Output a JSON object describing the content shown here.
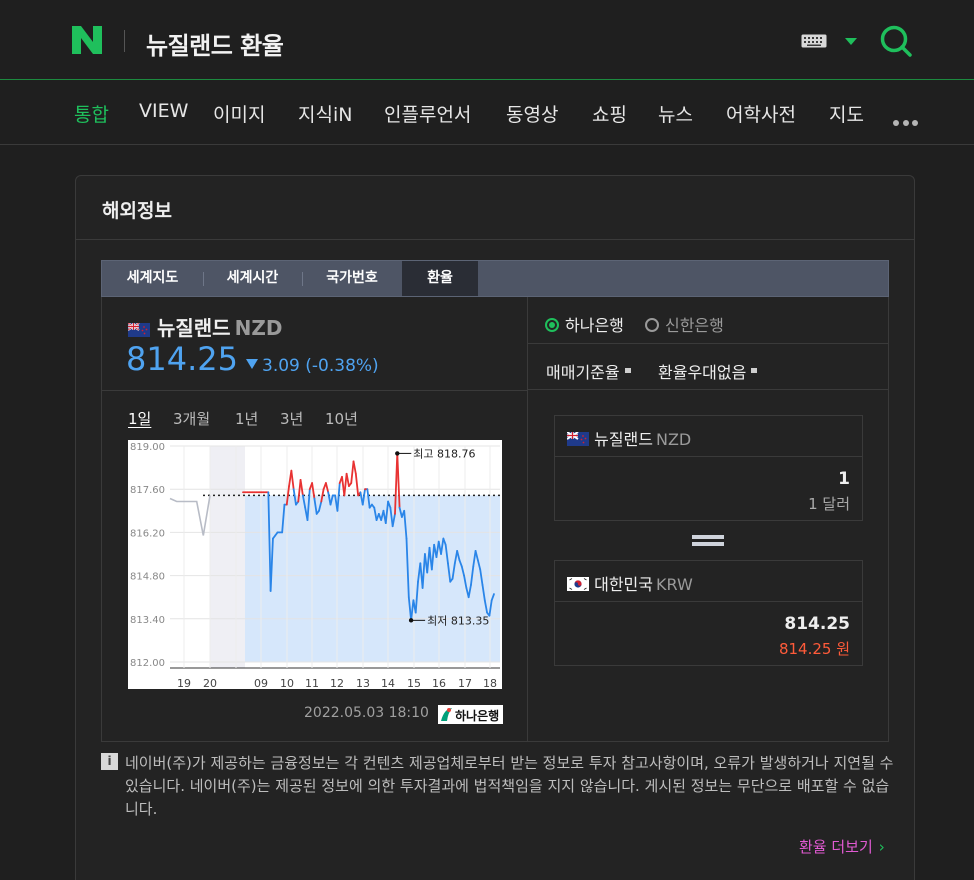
{
  "header": {
    "logo": "N",
    "query": "뉴질랜드 환율",
    "icons": [
      "keyboard-icon",
      "dropdown-triangle-icon",
      "search-icon"
    ],
    "accent_color": "#1fbf5c"
  },
  "tabs": [
    {
      "label": "통합",
      "active": true
    },
    {
      "label": "VIEW"
    },
    {
      "label": "이미지"
    },
    {
      "label": "지식iN"
    },
    {
      "label": "인플루언서"
    },
    {
      "label": "동영상"
    },
    {
      "label": "쇼핑"
    },
    {
      "label": "뉴스"
    },
    {
      "label": "어학사전"
    },
    {
      "label": "지도"
    }
  ],
  "card": {
    "title": "해외정보",
    "subtabs": [
      {
        "label": "세계지도"
      },
      {
        "label": "세계시간"
      },
      {
        "label": "국가번호"
      },
      {
        "label": "환율",
        "active": true
      }
    ]
  },
  "rate": {
    "country": "뉴질랜드",
    "code": "NZD",
    "value": "814.25",
    "change": "3.09",
    "change_pct": "(-0.38%)",
    "direction": "down",
    "color": "#4fa3f0"
  },
  "periods": [
    {
      "label": "1일",
      "active": true
    },
    {
      "label": "3개월"
    },
    {
      "label": "1년"
    },
    {
      "label": "3년"
    },
    {
      "label": "10년"
    }
  ],
  "chart": {
    "high_label": "최고 818.76",
    "low_label": "최저 813.35",
    "timestamp": "2022.05.03 18:10",
    "bank_logo": "하나은행"
  },
  "chart_data": {
    "type": "line",
    "ylim": [
      812.0,
      819.0
    ],
    "yticks": [
      "819.00",
      "817.60",
      "816.20",
      "814.80",
      "813.40",
      "812.00"
    ],
    "xticks": [
      "19",
      "20",
      "moon",
      "09",
      "10",
      "11",
      "12",
      "13",
      "14",
      "15",
      "16",
      "17",
      "18"
    ],
    "reference_line": 817.4,
    "high": 818.76,
    "low": 813.35,
    "series": [
      {
        "values": [
          817.3,
          817.2,
          817.2,
          817.2,
          817.2,
          816.1,
          817.4,
          817.5,
          817.5,
          817.5,
          817.5,
          817.5,
          817.5,
          817.5,
          817.5,
          817.5,
          817.5,
          817.5,
          817.5,
          814.3,
          816.0,
          816.1,
          816.2,
          816.2,
          816.2,
          817.1,
          817.1,
          817.7,
          818.2,
          817.6,
          817.1,
          817.2,
          817.9,
          817.4,
          817.0,
          816.6,
          817.6,
          817.8,
          817.3,
          816.8,
          816.9,
          817.2,
          817.6,
          817.8,
          817.5,
          817.1,
          817.4,
          817.4,
          816.9,
          817.8,
          818.0,
          817.4,
          818.1,
          817.7,
          817.8,
          818.5,
          818.1,
          817.4,
          817.5,
          817.1,
          817.6,
          817.6,
          817.0,
          817.1,
          817.0,
          816.6,
          816.8,
          816.6,
          816.9,
          816.5,
          817.2,
          817.0,
          816.4,
          816.8,
          818.76,
          817.0,
          816.7,
          816.9,
          816.0,
          814.1,
          813.35,
          814.0,
          813.6,
          814.6,
          815.2,
          814.4,
          815.5,
          814.9,
          815.7,
          815.0,
          815.8,
          815.4,
          815.9,
          815.5,
          816.0,
          815.8,
          815.2,
          814.6,
          814.7,
          815.2,
          815.6,
          815.3,
          815.1,
          814.8,
          814.4,
          814.1,
          814.5,
          815.1,
          815.6,
          815.3,
          815.0,
          814.5,
          814.0,
          813.6,
          813.5,
          814.0,
          814.2
        ]
      }
    ],
    "line_color": "#2a85e8",
    "up_color": "#e83232",
    "prev_color": "#b8bcc6"
  },
  "exchange": {
    "banks": [
      {
        "label": "하나은행",
        "selected": true
      },
      {
        "label": "신한은행",
        "selected": false
      }
    ],
    "options": [
      "매매기준율",
      "환율우대없음"
    ],
    "from": {
      "country": "뉴질랜드",
      "code": "NZD",
      "amount": "1",
      "unit": "1 달러"
    },
    "to": {
      "country": "대한민국",
      "code": "KRW",
      "amount": "814.25",
      "unit": "814.25 원"
    }
  },
  "notice": {
    "icon": "info-icon",
    "text": "네이버(주)가 제공하는 금융정보는 각 컨텐츠 제공업체로부터 받는 정보로 투자 참고사항이며, 오류가 발생하거나 지연될 수 있습니다. 네이버(주)는 제공된 정보에 의한 투자결과에 법적책임을 지지 않습니다. 게시된 정보는 무단으로 배포할 수 없습니다."
  },
  "more_link": "환율 더보기"
}
